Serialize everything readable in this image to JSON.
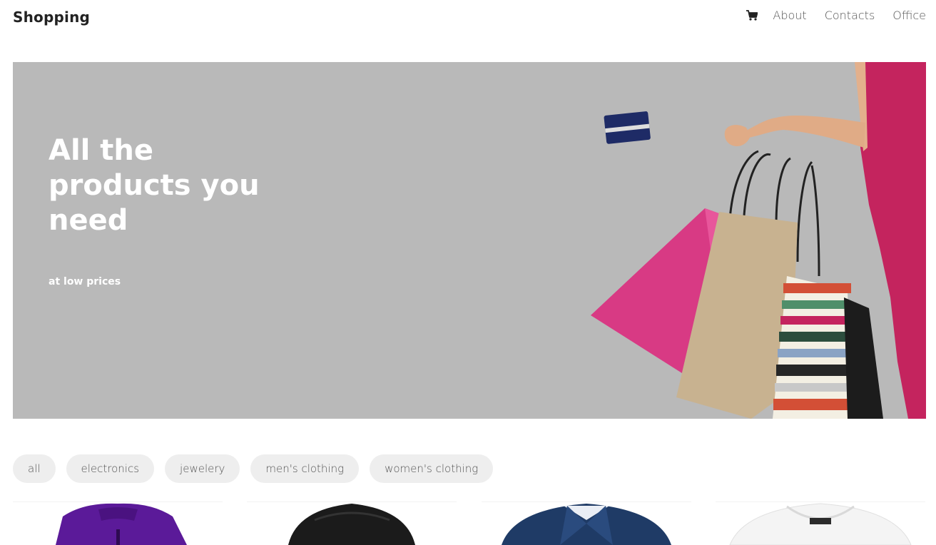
{
  "header": {
    "logo": "Shopping",
    "cart_icon": "shopping-cart-icon",
    "nav": [
      "About",
      "Contacts",
      "Office"
    ]
  },
  "hero": {
    "title": "All the products you need",
    "subtitle": "at low prices",
    "background": "#b9b9b9"
  },
  "filters": [
    "all",
    "electronics",
    "jewelery",
    "men's clothing",
    "women's clothing"
  ],
  "products": [
    {
      "image": "purple-jacket",
      "color": "#5b1a99"
    },
    {
      "image": "black-jacket",
      "color": "#1b1b1b"
    },
    {
      "image": "navy-jacket",
      "color": "#1f3b66"
    },
    {
      "image": "white-tshirt",
      "color": "#f4f4f4"
    }
  ]
}
